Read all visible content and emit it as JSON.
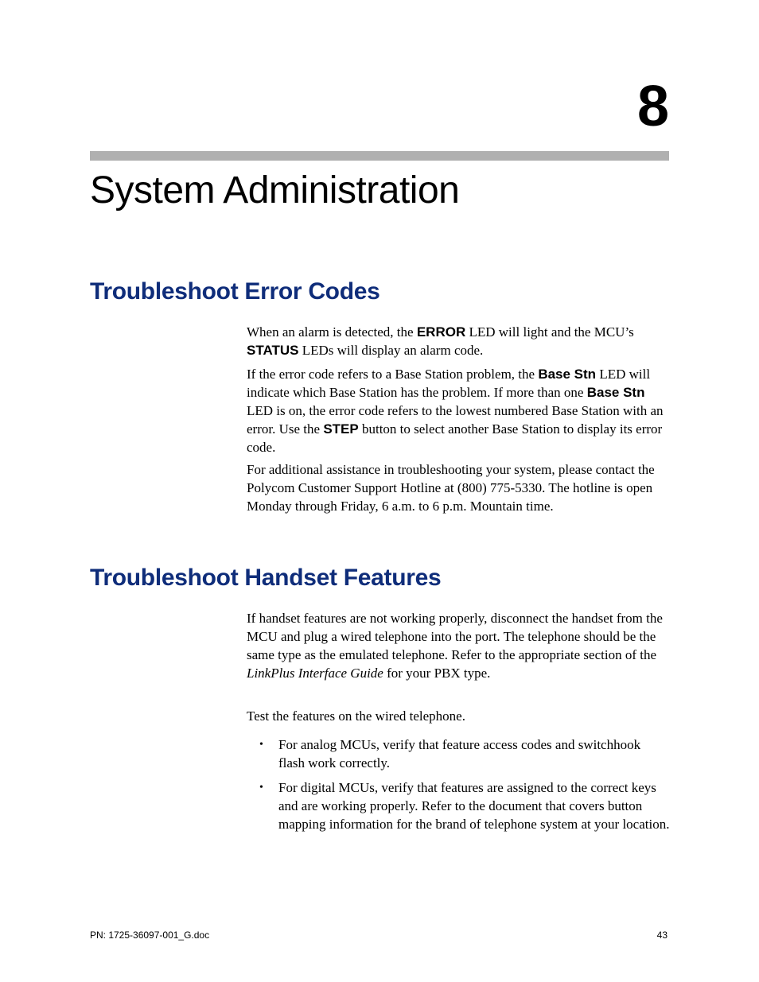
{
  "chapter": {
    "number": "8",
    "title": "System Administration"
  },
  "sections": [
    {
      "heading": "Troubleshoot Error Codes",
      "paragraphs": [
        {
          "runs": [
            {
              "t": "When an alarm is detected, the "
            },
            {
              "t": "ERROR",
              "style": "bold-sans"
            },
            {
              "t": " LED will light and the MCU’s "
            },
            {
              "t": "STATUS",
              "style": "bold-sans"
            },
            {
              "t": " LEDs will display an alarm code."
            }
          ]
        },
        {
          "runs": [
            {
              "t": "If the error code refers to a Base Station problem, the "
            },
            {
              "t": "Base Stn",
              "style": "bold-sans"
            },
            {
              "t": " LED will indicate which Base Station has the problem. If more than one "
            },
            {
              "t": "Base Stn",
              "style": "bold-sans"
            },
            {
              "t": " LED is on, the error code refers to the lowest numbered Base Station with an error. Use the "
            },
            {
              "t": "STEP",
              "style": "bold-sans"
            },
            {
              "t": " button to select another Base Station to display its error code."
            }
          ]
        },
        {
          "runs": [
            {
              "t": "For additional assistance in troubleshooting your system, please contact the Polycom Customer Support Hotline at  (800) 775-5330. The hotline is open Monday through Friday, 6 a.m. to 6 p.m. Mountain time."
            }
          ]
        }
      ]
    },
    {
      "heading": "Troubleshoot Handset Features",
      "paragraphs": [
        {
          "runs": [
            {
              "t": "If handset features are not working properly, disconnect the handset from the MCU and plug a wired telephone into the port. The telephone should be the same type as the emulated telephone. Refer to the appropriate section of the "
            },
            {
              "t": "LinkPlus Interface Guide",
              "style": "italic"
            },
            {
              "t": " for your PBX type."
            }
          ]
        },
        {
          "runs": [
            {
              "t": "Test the features on the wired telephone."
            }
          ]
        }
      ],
      "bullets": [
        {
          "runs": [
            {
              "t": "For analog MCUs, verify that feature access codes and switchhook flash work correctly."
            }
          ]
        },
        {
          "runs": [
            {
              "t": "For digital MCUs, verify that features are assigned to the correct keys and are working properly. Refer to the document that covers button mapping information for the brand of telephone system at your location."
            }
          ]
        }
      ]
    }
  ],
  "footer": {
    "left": "PN: 1725-36097-001_G.doc",
    "right": "43"
  }
}
